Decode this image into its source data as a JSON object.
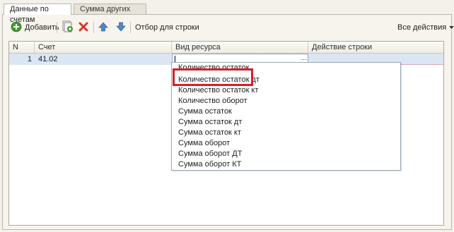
{
  "tabs": [
    {
      "label": "Данные по счетам"
    },
    {
      "label": "Сумма других строк"
    }
  ],
  "toolbar": {
    "add_label": "Добавить",
    "filter_label": "Отбор для строки",
    "actions_label": "Все действия"
  },
  "grid": {
    "columns": [
      {
        "label": "N"
      },
      {
        "label": "Счет"
      },
      {
        "label": "Вид ресурса"
      },
      {
        "label": "Действие строки"
      }
    ],
    "rows": [
      {
        "n": "1",
        "account": "41.02",
        "resource": "",
        "action": ""
      }
    ],
    "editor_button_label": "..."
  },
  "dropdown": {
    "items": [
      "Количество остаток",
      "Количество остаток дт",
      "Количество остаток кт",
      "Количество оборот",
      "Сумма остаток",
      "Сумма остаток дт",
      "Сумма остаток кт",
      "Сумма оборот",
      "Сумма оборот ДТ",
      "Сумма оборот КТ"
    ]
  },
  "icons": {
    "add": "add-circle-icon",
    "copy": "copy-icon",
    "delete": "delete-x-icon",
    "up": "move-up-icon",
    "down": "move-down-icon",
    "actions": "dropdown-arrow-icon"
  },
  "colors": {
    "highlight_border": "#d62027",
    "selected_row": "#dbe6f4",
    "delete_icon": "#d9362b",
    "arrow_icon": "#4f86c6",
    "add_icon": "#3f9b2f"
  }
}
